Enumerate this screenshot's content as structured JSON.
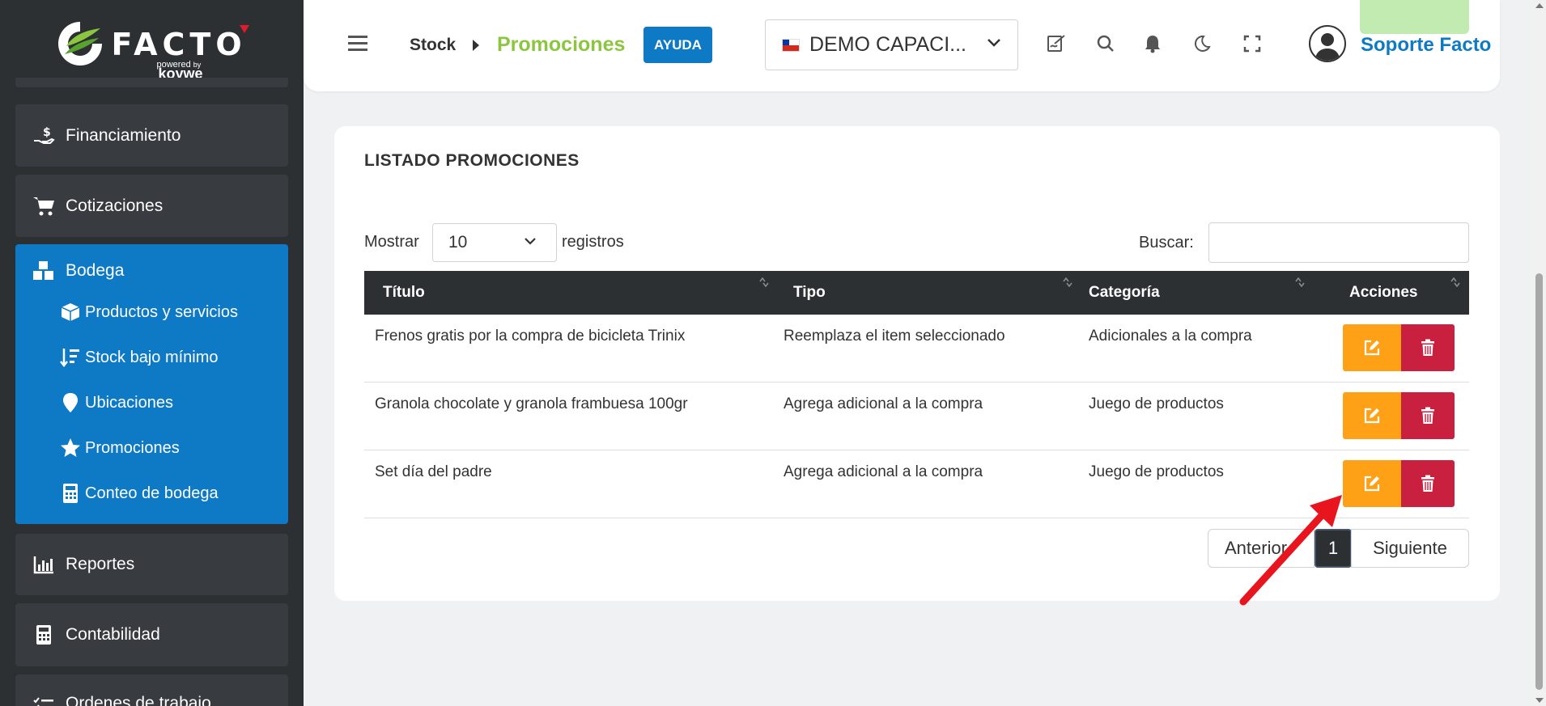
{
  "brand": {
    "name": "FACTO",
    "powered": "powered",
    "by": "by",
    "partner": "koywe"
  },
  "sidebar": {
    "items": [
      {
        "label": "Financiamiento",
        "icon": "hand-dollar-icon"
      },
      {
        "label": "Cotizaciones",
        "icon": "cart-icon"
      },
      {
        "label": "Reportes",
        "icon": "bar-chart-icon"
      },
      {
        "label": "Contabilidad",
        "icon": "calculator-icon"
      },
      {
        "label": "Ordenes de trabajo",
        "icon": "list-check-icon"
      }
    ],
    "bodega": {
      "label": "Bodega",
      "icon": "cubes-icon",
      "sub_items": [
        {
          "label": "Productos y servicios",
          "icon": "box-icon"
        },
        {
          "label": "Stock bajo mínimo",
          "icon": "sort-amount-icon"
        },
        {
          "label": "Ubicaciones",
          "icon": "map-pin-icon"
        },
        {
          "label": "Promociones",
          "icon": "star-icon"
        },
        {
          "label": "Conteo de bodega",
          "icon": "calculator-icon"
        }
      ]
    }
  },
  "header": {
    "breadcrumb_parent": "Stock",
    "breadcrumb_current": "Promociones",
    "help_label": "AYUDA",
    "company_name": "DEMO CAPACI...",
    "user_name": "Soporte Facto",
    "icons": [
      "signature-icon",
      "search-icon",
      "bell-icon",
      "moon-icon",
      "fullscreen-icon"
    ]
  },
  "main": {
    "title": "LISTADO PROMOCIONES",
    "show_label": "Mostrar",
    "show_value": "10",
    "records_label": "registros",
    "search_label": "Buscar:",
    "search_value": "",
    "columns": [
      "Título",
      "Tipo",
      "Categoría",
      "Acciones"
    ],
    "rows": [
      {
        "titulo": "Frenos gratis por la compra de bicicleta Trinix",
        "tipo": "Reemplaza el item seleccionado",
        "categoria": "Adicionales a la compra"
      },
      {
        "titulo": "Granola chocolate y granola frambuesa 100gr",
        "tipo": "Agrega adicional a la compra",
        "categoria": "Juego de productos"
      },
      {
        "titulo": "Set día del padre",
        "tipo": "Agrega adicional a la compra",
        "categoria": "Juego de productos"
      }
    ],
    "pagination": {
      "prev": "Anterior",
      "current": "1",
      "next": "Siguiente"
    }
  },
  "colors": {
    "sidebar_bg": "#2d3033",
    "active_blue": "#0e79c4",
    "brand_green": "#8cc63f",
    "edit_orange": "#ffa117",
    "delete_red": "#c9203f",
    "annotation_red": "#e8141e"
  }
}
